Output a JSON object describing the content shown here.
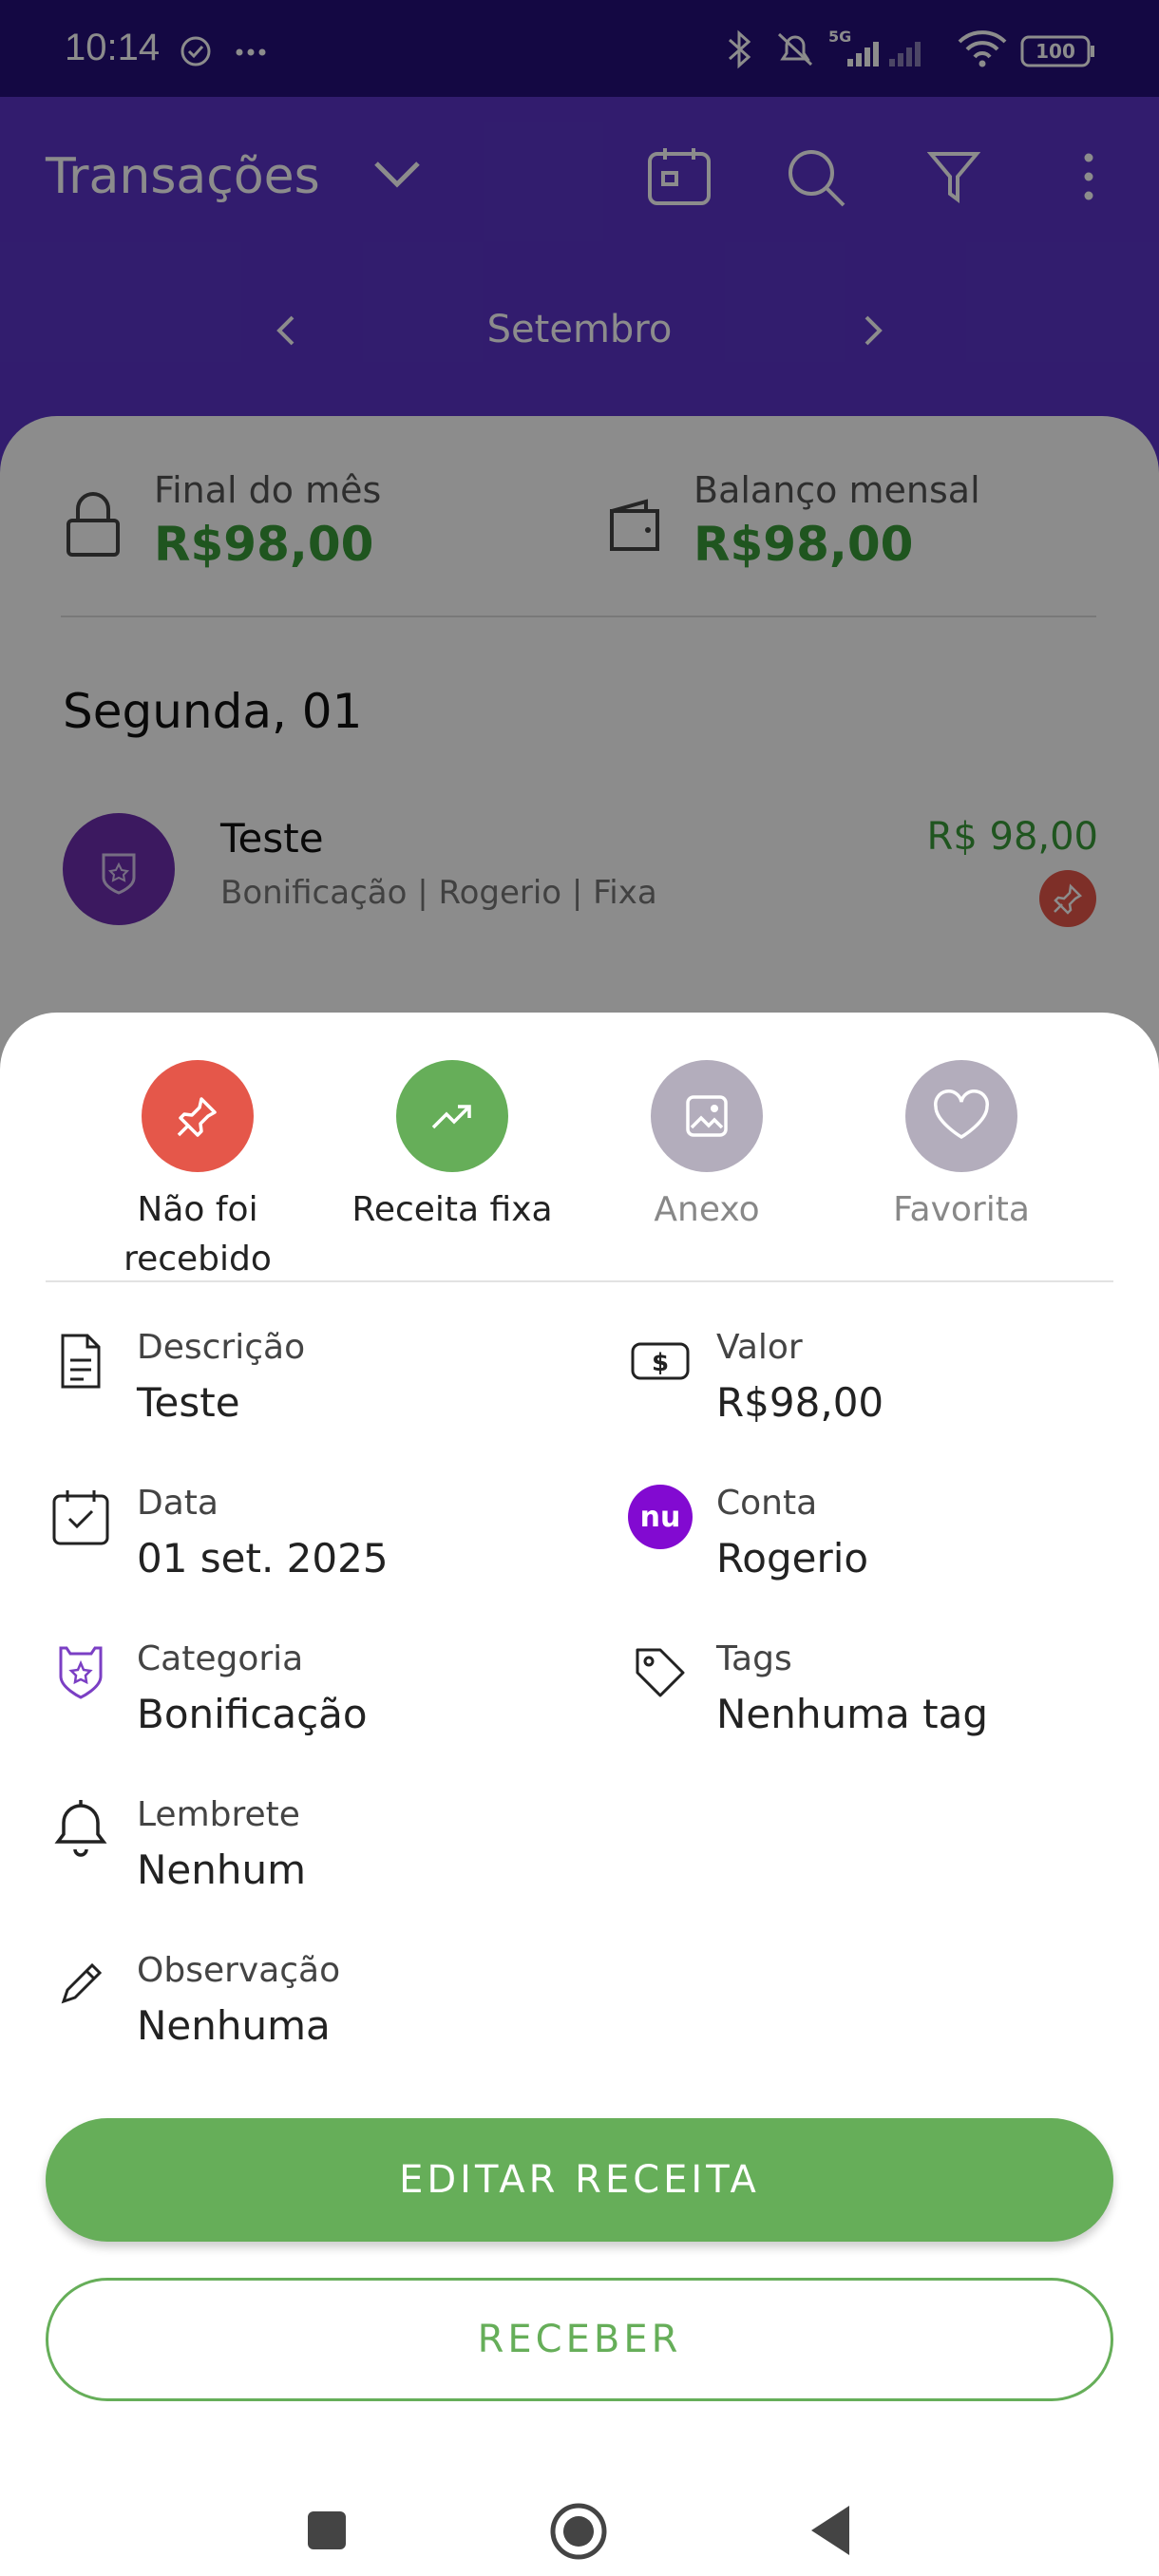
{
  "status_bar": {
    "time": "10:14",
    "battery": "100",
    "network": "5G"
  },
  "app_bar": {
    "title": "Transações",
    "month": "Setembro"
  },
  "summary": {
    "end_of_month_label": "Final do mês",
    "end_of_month_value": "R$98,00",
    "monthly_balance_label": "Balanço mensal",
    "monthly_balance_value": "R$98,00"
  },
  "day_header": "Segunda, 01",
  "transaction": {
    "title": "Teste",
    "subtitle": "Bonificação | Rogerio  | Fixa",
    "amount": "R$ 98,00"
  },
  "sheet": {
    "actions": [
      {
        "label": "Não foi recebido",
        "icon": "pin-icon",
        "color": "#e5574a"
      },
      {
        "label": "Receita fixa",
        "icon": "trending-up-icon",
        "color": "#66ae59"
      },
      {
        "label": "Anexo",
        "icon": "image-icon",
        "color": "#b3adbc"
      },
      {
        "label": "Favorita",
        "icon": "heart-icon",
        "color": "#b3adbc"
      }
    ],
    "fields": {
      "descricao": {
        "label": "Descrição",
        "value": "Teste"
      },
      "valor": {
        "label": "Valor",
        "value": "R$98,00"
      },
      "data": {
        "label": "Data",
        "value": "01 set. 2025"
      },
      "conta": {
        "label": "Conta",
        "value": "Rogerio",
        "badge": "nu"
      },
      "categoria": {
        "label": "Categoria",
        "value": "Bonificação"
      },
      "tags": {
        "label": "Tags",
        "value": "Nenhuma tag"
      },
      "lembrete": {
        "label": "Lembrete",
        "value": "Nenhum"
      },
      "observacao": {
        "label": "Observação",
        "value": "Nenhuma"
      }
    },
    "edit_button": "EDITAR RECEITA",
    "receive_button": "RECEBER"
  },
  "colors": {
    "primary": "#5b34c8",
    "status_bar": "#26107a",
    "green": "#66ae59",
    "red": "#e5574a",
    "purple": "#6d2fb0"
  }
}
